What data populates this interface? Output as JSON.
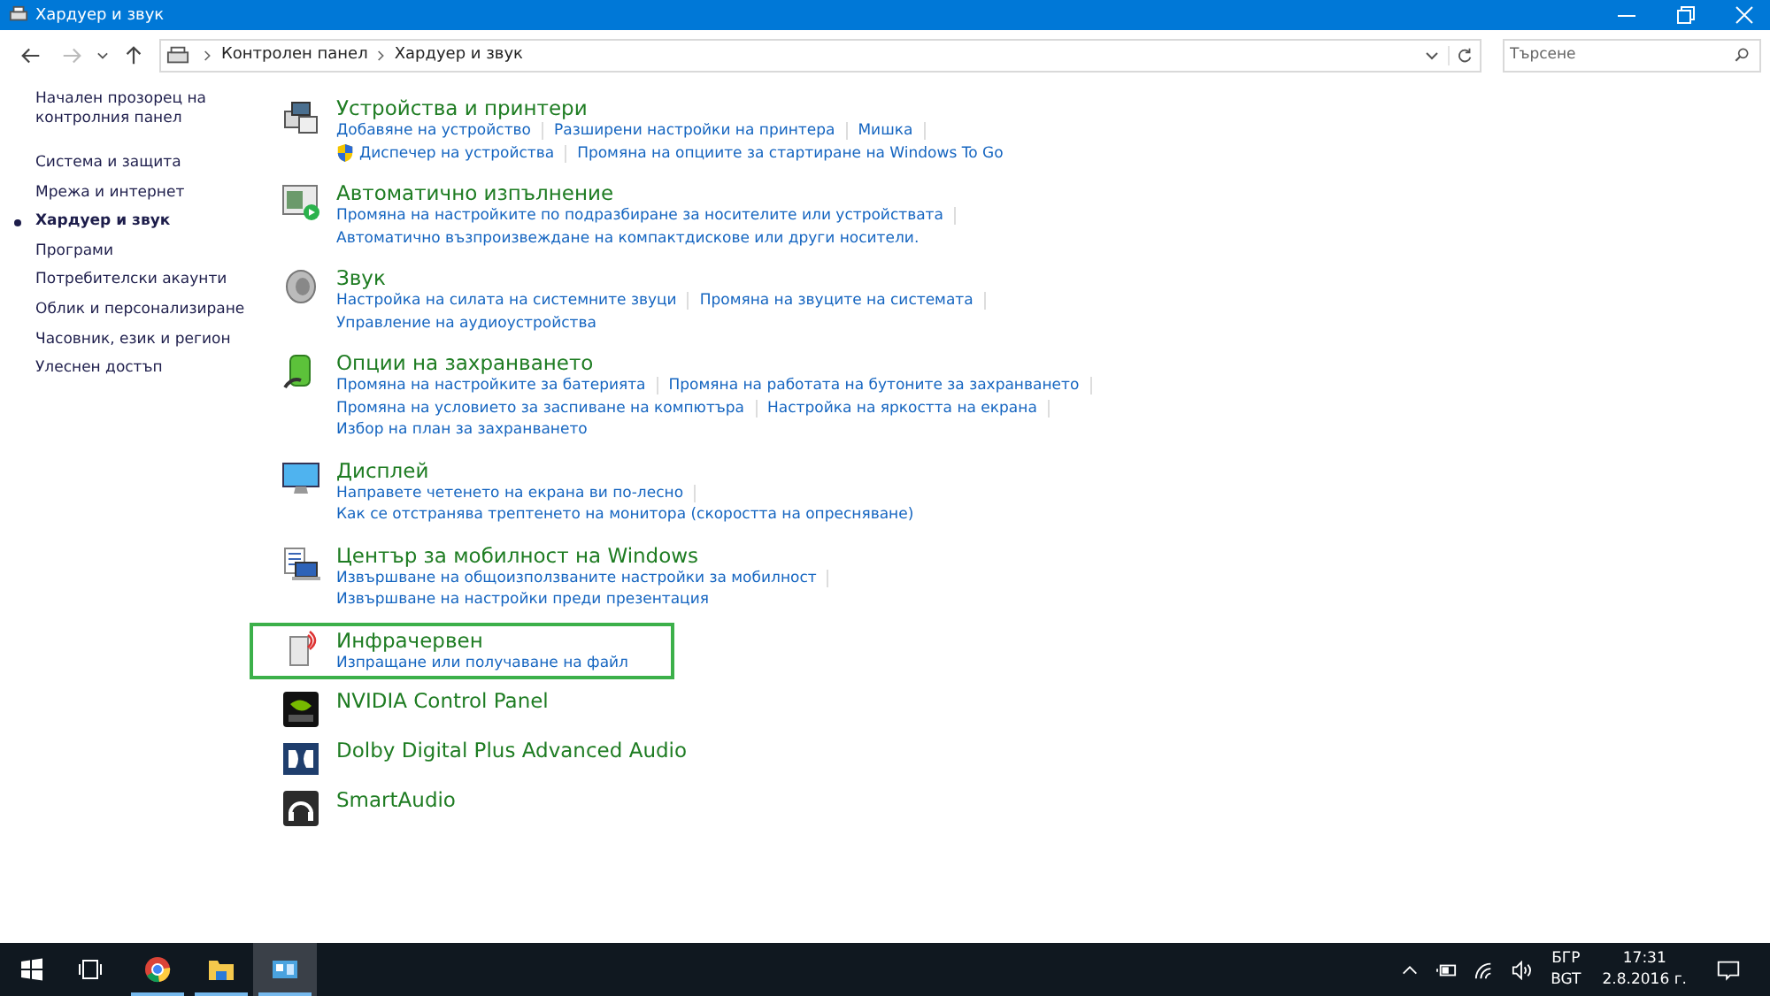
{
  "window": {
    "title": "Хардуер и звук"
  },
  "address_bar": {
    "crumbs": [
      "Контролен панел",
      "Хардуер и звук"
    ]
  },
  "search": {
    "placeholder": "Търсене"
  },
  "sidebar": {
    "items": [
      {
        "label": "Начален прозорец на контролния панел",
        "selected": false
      },
      {
        "label": "Система и защита",
        "selected": false
      },
      {
        "label": "Мрежа и интернет",
        "selected": false
      },
      {
        "label": "Хардуер и звук",
        "selected": true
      },
      {
        "label": "Програми",
        "selected": false
      },
      {
        "label": "Потребителски акаунти",
        "selected": false
      },
      {
        "label": "Облик и персонализиране",
        "selected": false
      },
      {
        "label": "Часовник, език и регион",
        "selected": false
      },
      {
        "label": "Улеснен достъп",
        "selected": false
      }
    ]
  },
  "categories": [
    {
      "title": "Устройства и принтери",
      "highlighted": false,
      "link_rows": [
        [
          "Добавяне на устройство",
          "Разширени настройки на принтера",
          "Мишка"
        ],
        [
          "Диспечер на устройства",
          "Промяна на опциите за стартиране на Windows To Go"
        ]
      ]
    },
    {
      "title": "Автоматично изпълнение",
      "highlighted": false,
      "link_rows": [
        [
          "Промяна на настройките по подразбиране за носителите или устройствата"
        ],
        [
          "Автоматично възпроизвеждане на компактдискове или други носители."
        ]
      ]
    },
    {
      "title": "Звук",
      "highlighted": false,
      "link_rows": [
        [
          "Настройка на силата на системните звуци",
          "Промяна на звуците на системата"
        ],
        [
          "Управление на аудиоустройства"
        ]
      ]
    },
    {
      "title": "Опции на захранването",
      "highlighted": false,
      "link_rows": [
        [
          "Промяна на настройките за батерията",
          "Промяна на работата на бутоните за захранването"
        ],
        [
          "Промяна на условието за заспиване на компютъра",
          "Настройка на яркостта на екрана"
        ],
        [
          "Избор на план за захранването"
        ]
      ]
    },
    {
      "title": "Дисплей",
      "highlighted": false,
      "link_rows": [
        [
          "Направете четенето на екрана ви по-лесно"
        ],
        [
          "Как се отстранява трептенето на монитора (скоростта на опресняване)"
        ]
      ]
    },
    {
      "title": "Център за мобилност на Windows",
      "highlighted": false,
      "link_rows": [
        [
          "Извършване на общоизползваните настройки за мобилност"
        ],
        [
          "Извършване на настройки преди презентация"
        ]
      ]
    },
    {
      "title": "Инфрачервен",
      "highlighted": true,
      "link_rows": [
        [
          "Изпращане или получаване на файл"
        ]
      ]
    },
    {
      "title": "NVIDIA Control Panel",
      "highlighted": false
    },
    {
      "title": "Dolby Digital Plus Advanced Audio",
      "highlighted": false
    },
    {
      "title": "SmartAudio",
      "highlighted": false
    }
  ],
  "taskbar": {
    "apps": [
      {
        "running": true,
        "selected": false
      },
      {
        "running": true,
        "selected": false
      },
      {
        "running": true,
        "selected": true
      }
    ],
    "language": [
      "БГР",
      "BGT"
    ],
    "time": "17:31",
    "date": "2.8.2016 г."
  }
}
